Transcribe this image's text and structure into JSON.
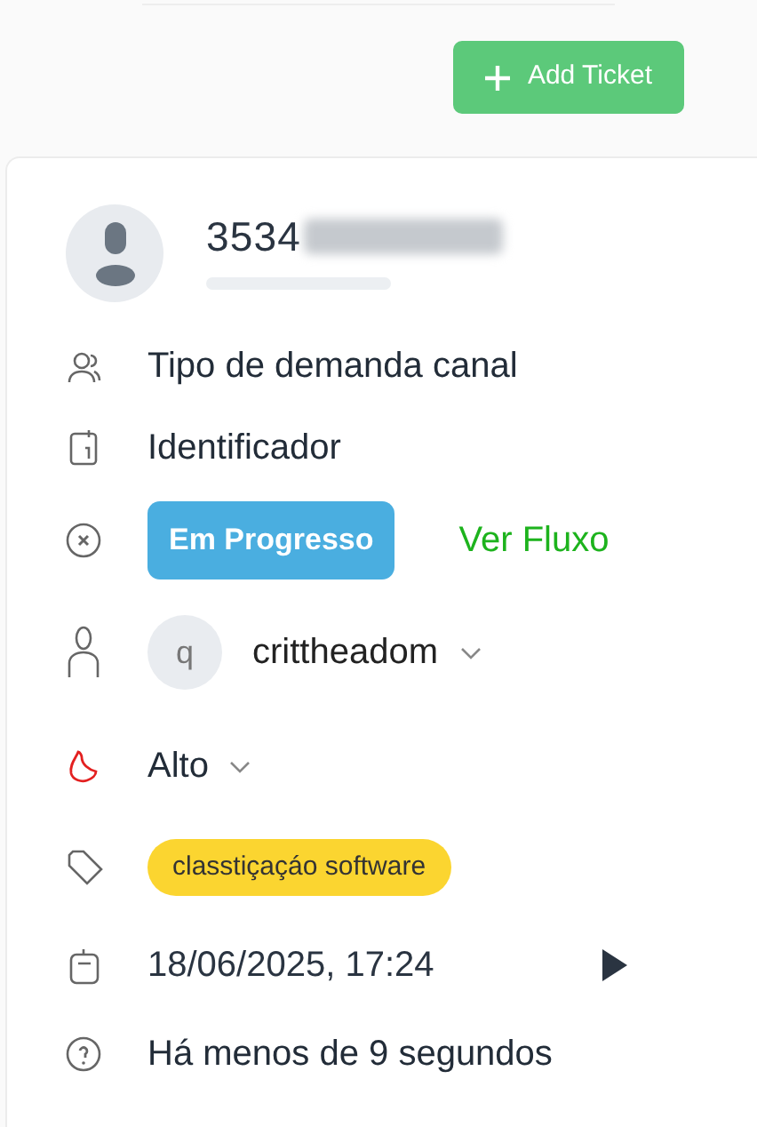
{
  "add_button": {
    "label": "Add Ticket"
  },
  "ticket": {
    "number": "3534",
    "number_redacted": true,
    "fields": [
      {
        "kind": "text",
        "text": "Tipo de demanda canal"
      },
      {
        "kind": "text",
        "text": "Identificador"
      },
      {
        "kind": "status",
        "badge": "Em Progresso",
        "link": "Ver Fluxo"
      },
      {
        "kind": "assignee",
        "avatar": "q",
        "text": "crittheadom"
      },
      {
        "kind": "priority",
        "text": "Alto"
      },
      {
        "kind": "tag",
        "text": "classtiçaçáo software",
        "color": "#fbd530"
      },
      {
        "kind": "date",
        "text": "18/06/2025, 17:24"
      },
      {
        "kind": "text",
        "text": "Há menos de 9 segundos"
      }
    ]
  }
}
